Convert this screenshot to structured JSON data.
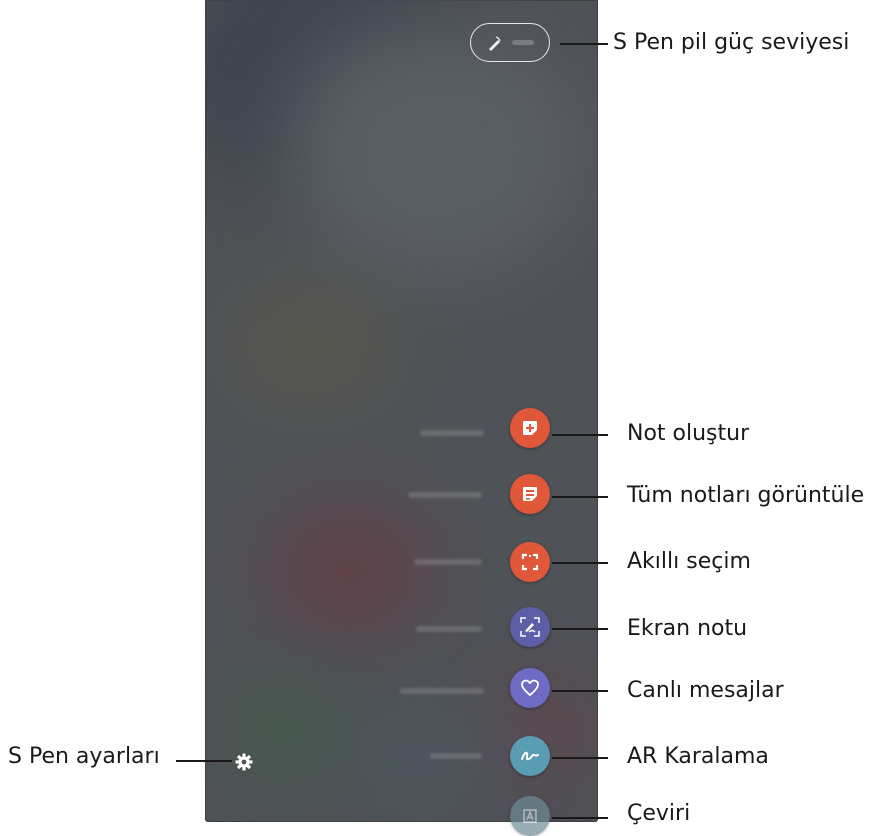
{
  "callouts": {
    "battery": "S Pen pil güç seviyesi",
    "create_note": "Not oluştur",
    "view_all_notes": "Tüm notları görüntüle",
    "smart_select": "Akıllı seçim",
    "screen_write": "Ekran notu",
    "live_messages": "Canlı mesajlar",
    "ar_doodle": "AR Karalama",
    "translate": "Çeviri",
    "settings": "S Pen ayarları"
  },
  "icons": {
    "battery": "pen-battery-icon",
    "create_note": "note-plus-icon",
    "view_all_notes": "notes-list-icon",
    "smart_select": "smart-select-icon",
    "screen_write": "screen-write-icon",
    "live_messages": "heart-message-icon",
    "ar_doodle": "ar-doodle-icon",
    "translate": "translate-icon",
    "settings": "gear-icon"
  },
  "colors": {
    "create_note": "#e0573a",
    "view_all_notes": "#e0573a",
    "smart_select": "#e0573a",
    "screen_write": "#5c5fa8",
    "live_messages": "#6e6bc4",
    "ar_doodle": "#5a9cb2",
    "translate": "#6e8b96"
  }
}
